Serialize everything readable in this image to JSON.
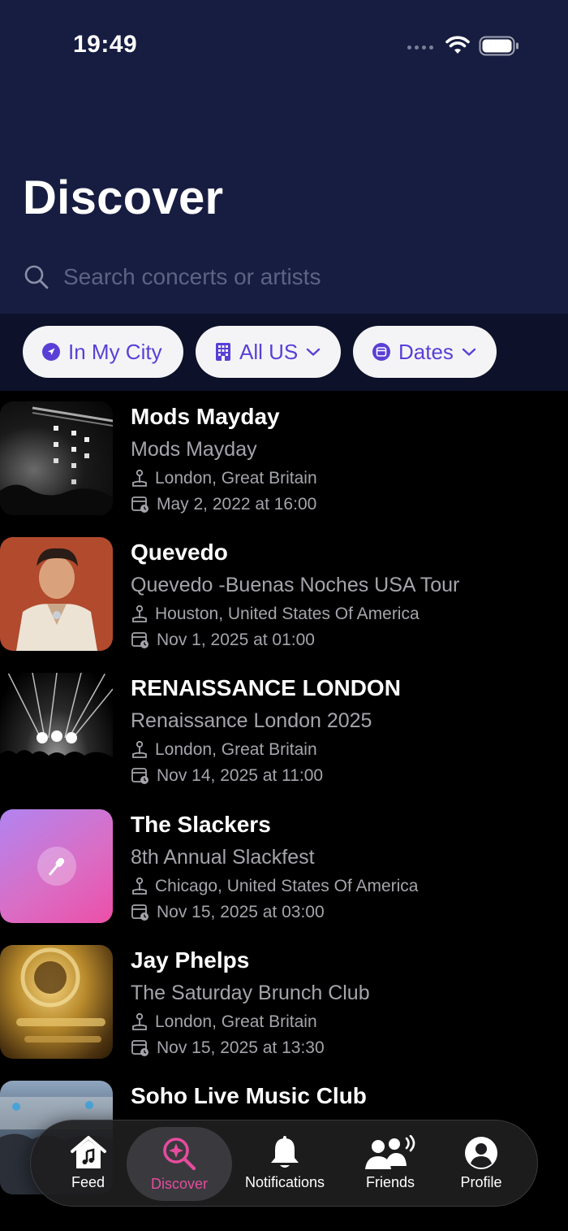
{
  "status_bar": {
    "time": "19:49"
  },
  "header": {
    "title": "Discover",
    "search_placeholder": "Search concerts or artists"
  },
  "filters": [
    {
      "label": "In My City",
      "icon": "location-arrow-icon"
    },
    {
      "label": "All US",
      "icon": "building-icon"
    },
    {
      "label": "Dates",
      "icon": "calendar-icon"
    }
  ],
  "events": [
    {
      "artist": "Mods Mayday",
      "event": "Mods Mayday",
      "location": "London, Great Britain",
      "date": "May 2, 2022 at 16:00"
    },
    {
      "artist": "Quevedo",
      "event": "Quevedo -Buenas Noches USA Tour",
      "location": "Houston, United States Of America",
      "date": "Nov 1, 2025 at 01:00"
    },
    {
      "artist": "RENAISSANCE LONDON",
      "event": "Renaissance London 2025",
      "location": "London, Great Britain",
      "date": "Nov 14, 2025 at 11:00"
    },
    {
      "artist": "The Slackers",
      "event": "8th Annual Slackfest",
      "location": "Chicago, United States Of America",
      "date": "Nov 15, 2025 at 03:00"
    },
    {
      "artist": "Jay Phelps",
      "event": "The Saturday Brunch Club",
      "location": "London, Great Britain",
      "date": "Nov 15, 2025 at 13:30"
    },
    {
      "artist": "Soho Live Music Club",
      "event": "",
      "location": "",
      "date": ""
    }
  ],
  "tabbar": [
    {
      "label": "Feed",
      "icon": "home-music-icon"
    },
    {
      "label": "Discover",
      "icon": "discover-search-icon",
      "active": true
    },
    {
      "label": "Notifications",
      "icon": "bell-icon"
    },
    {
      "label": "Friends",
      "icon": "friends-icon"
    },
    {
      "label": "Profile",
      "icon": "profile-icon"
    }
  ],
  "colors": {
    "header_bg": "#171d41",
    "filter_bar_bg": "#0d1129",
    "chip_bg": "#f4f4f7",
    "chip_accent": "#5a3fd6",
    "active_tab": "#e64c9e",
    "secondary_text": "#a4a4ab"
  }
}
